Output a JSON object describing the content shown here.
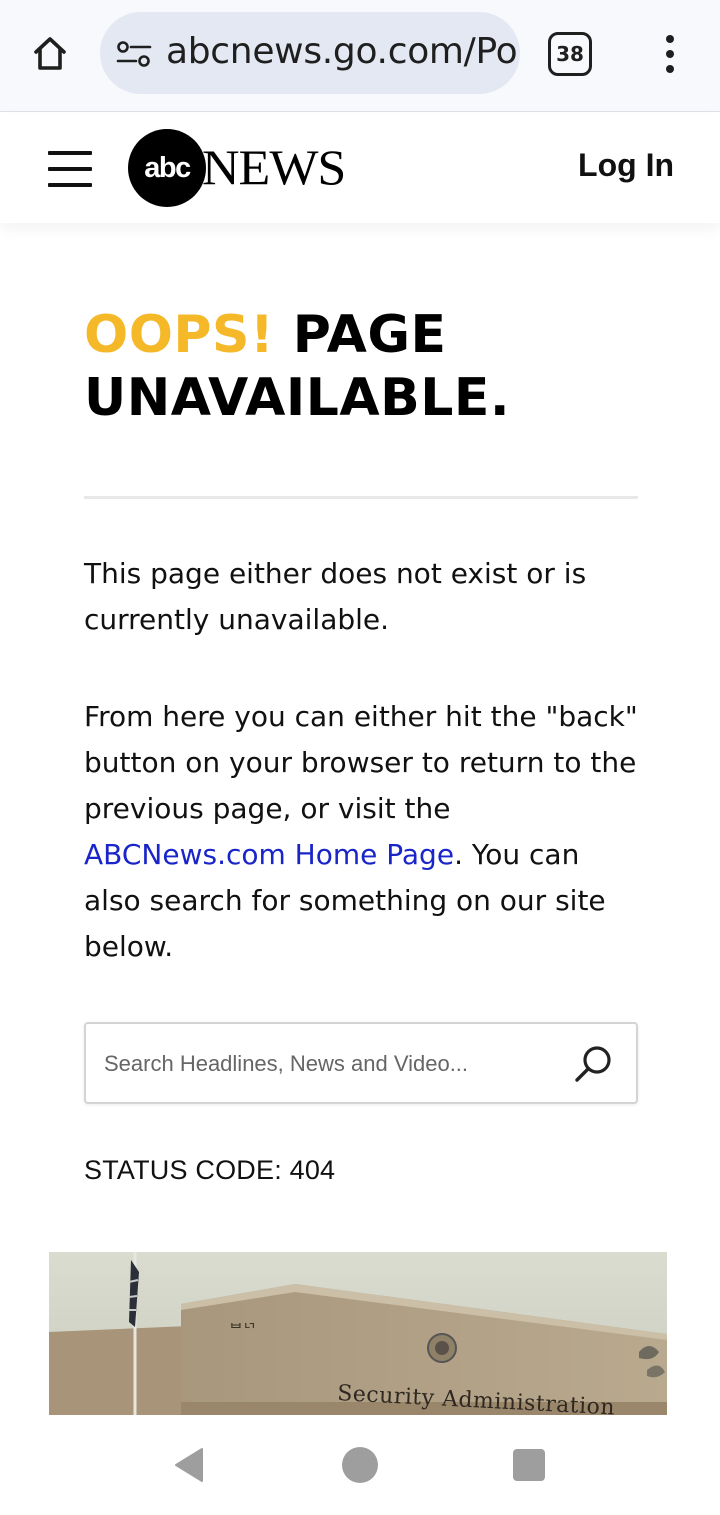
{
  "browser": {
    "url": "abcnews.go.com/Po",
    "tab_count": "38"
  },
  "header": {
    "logo_mark": "abc",
    "logo_word": "NEWS",
    "login_label": "Log In"
  },
  "error_page": {
    "headline_accent": "OOPS!",
    "headline_rest": " PAGE UNAVAILABLE.",
    "paragraph_1": "This page either does not exist or is currently unavailable.",
    "paragraph_2_before_link": "From here you can either hit the \"back\" button on your browser to return to the previous page, or visit the ",
    "home_link_label": "ABCNews.com Home Page",
    "paragraph_2_after_link": ". You can also search for something on our site below.",
    "search_placeholder": "Search Headlines, News and Video...",
    "status_code": "STATUS CODE: 404"
  },
  "photo": {
    "sign_text": "SECURITY ADMINISTRATION",
    "sign_number": "ᄇᄓ"
  },
  "colors": {
    "accent_yellow": "#f4b829",
    "link_blue": "#1a25c9"
  }
}
